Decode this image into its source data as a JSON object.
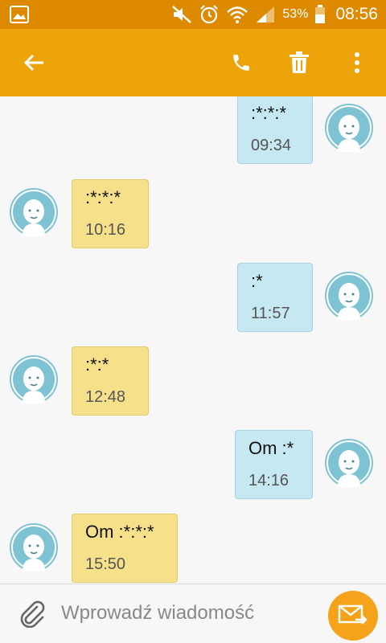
{
  "status_bar": {
    "battery_percent": "53%",
    "time": "08:56",
    "icons": [
      "gallery-icon",
      "mute-icon",
      "alarm-icon",
      "wifi-icon",
      "signal-icon",
      "battery-icon"
    ]
  },
  "app_bar": {
    "icons": [
      "back-arrow-icon",
      "phone-icon",
      "trash-icon",
      "more-vert-icon"
    ]
  },
  "messages": [
    {
      "direction": "out",
      "text": ":*:*:*",
      "time": "09:34"
    },
    {
      "direction": "in",
      "text": ":*:*:*",
      "time": "10:16"
    },
    {
      "direction": "out",
      "text": ":*",
      "time": "11:57"
    },
    {
      "direction": "in",
      "text": ":*:*",
      "time": "12:48"
    },
    {
      "direction": "out",
      "text": "Om :*",
      "time": "14:16"
    },
    {
      "direction": "in",
      "text": "Om :*:*:*",
      "time": "15:50"
    }
  ],
  "composer": {
    "placeholder": "Wprowadź wiadomość",
    "value": ""
  },
  "colors": {
    "status_bar": "#dd8a00",
    "app_bar": "#eda30a",
    "incoming_bubble": "#f6e18a",
    "outgoing_bubble": "#c6e8f2",
    "avatar": "#7dc3d3",
    "send_button": "#f5a31b"
  }
}
